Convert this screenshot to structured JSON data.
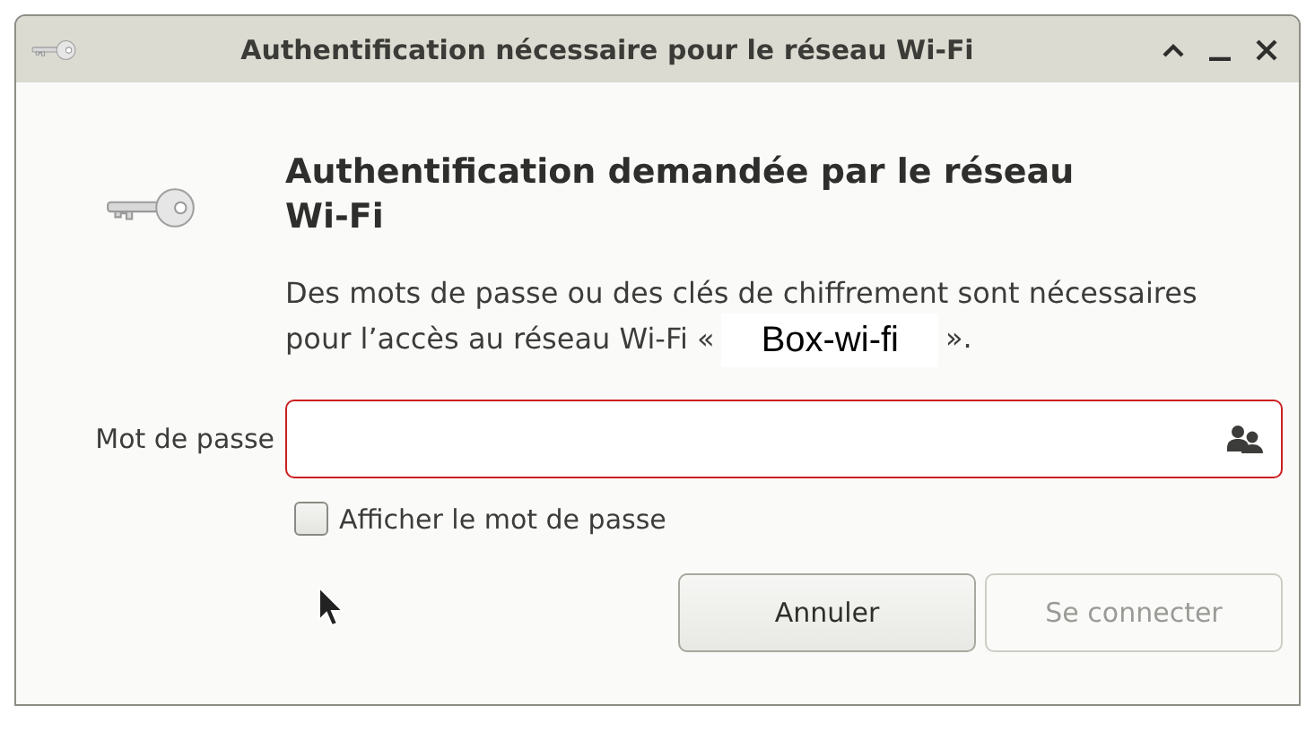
{
  "window": {
    "title": "Authentification nécessaire pour le réseau Wi-Fi"
  },
  "heading": "Authentification demandée par le réseau Wi-Fi",
  "description": {
    "before": "Des mots de passe ou des clés de chiffrement sont nécessaires pour l’accès au réseau Wi-Fi «",
    "network": "Box-wi-fi",
    "after": "»."
  },
  "password": {
    "label": "Mot de passe",
    "invalid": true
  },
  "show_password": {
    "label": "Afficher le mot de passe",
    "checked": false
  },
  "buttons": [
    {
      "label": "Annuler",
      "disabled": false
    },
    {
      "label": "Se connecter",
      "disabled": true
    }
  ]
}
